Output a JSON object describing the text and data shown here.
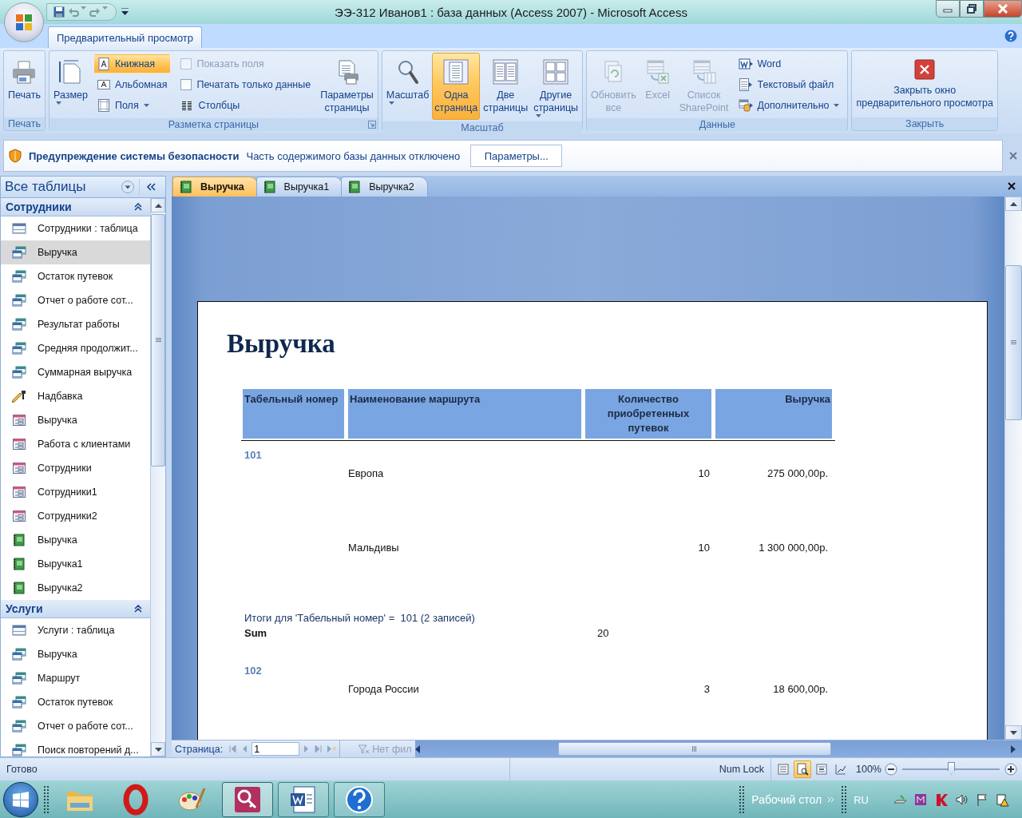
{
  "window": {
    "title": "ЭЭ-312 Иванов1 : база данных (Access 2007) - Microsoft Access"
  },
  "ribbon": {
    "tabs": [
      {
        "label": "Предварительный просмотр",
        "selected": true
      }
    ],
    "groups": [
      {
        "label": "Печать",
        "controls": [
          {
            "kind": "large",
            "label": "Печать"
          }
        ]
      },
      {
        "label": "Разметка страницы",
        "launcher": true,
        "controls": [
          {
            "kind": "large",
            "label": "Размер",
            "dropdown": true
          },
          {
            "kind": "stack",
            "items": [
              {
                "kind": "toggle",
                "label": "Книжная",
                "selected": true
              },
              {
                "kind": "toggle",
                "label": "Альбомная",
                "selected": false
              },
              {
                "kind": "small",
                "label": "Поля",
                "dropdown": true
              }
            ]
          },
          {
            "kind": "stack",
            "items": [
              {
                "kind": "check",
                "label": "Показать поля",
                "checked": false,
                "disabled": true
              },
              {
                "kind": "check",
                "label": "Печатать только данные",
                "checked": false,
                "disabled": false
              },
              {
                "kind": "small",
                "label": "Столбцы"
              }
            ]
          },
          {
            "kind": "large",
            "label": "Параметры\nстраницы"
          }
        ]
      },
      {
        "label": "Масштаб",
        "controls": [
          {
            "kind": "large",
            "label": "Масштаб",
            "dropdown": true,
            "selected": false
          },
          {
            "kind": "large",
            "label": "Одна\nстраница",
            "selected": true
          },
          {
            "kind": "large",
            "label": "Две\nстраницы",
            "selected": false
          },
          {
            "kind": "large",
            "label": "Другие\nстраницы",
            "dropdown": true,
            "selected": false
          }
        ]
      },
      {
        "label": "Данные",
        "controls": [
          {
            "kind": "large",
            "label": "Обновить\nвсе",
            "disabled": true
          },
          {
            "kind": "large",
            "label": "Excel\n ",
            "disabled": true
          },
          {
            "kind": "large",
            "label": "Список\nSharePoint",
            "disabled": true
          },
          {
            "kind": "stack",
            "items": [
              {
                "kind": "small",
                "label": "Word",
                "disabled": false
              },
              {
                "kind": "small",
                "label": "Текстовый файл",
                "disabled": false
              },
              {
                "kind": "small",
                "label": "Дополнительно",
                "dropdown": true,
                "disabled": false
              }
            ]
          }
        ]
      },
      {
        "label": "Закрыть",
        "controls": [
          {
            "kind": "large",
            "label": "Закрыть окно\nпредварительного просмотра"
          }
        ]
      }
    ]
  },
  "security_bar": {
    "title": "Предупреждение системы безопасности",
    "message": "Часть содержимого базы данных отключено",
    "button": "Параметры..."
  },
  "nav_pane": {
    "title": "Все таблицы",
    "groups": [
      {
        "label": "Сотрудники",
        "expanded": true,
        "items": [
          {
            "label": "Сотрудники : таблица",
            "kind": "table",
            "selected": false
          },
          {
            "label": "Выручка",
            "kind": "query",
            "selected": true
          },
          {
            "label": "Остаток путевок",
            "kind": "query",
            "selected": false
          },
          {
            "label": "Отчет о работе сот...",
            "kind": "query",
            "selected": false
          },
          {
            "label": "Результат работы",
            "kind": "query",
            "selected": false
          },
          {
            "label": "Средняя продолжит...",
            "kind": "query",
            "selected": false
          },
          {
            "label": "Суммарная выручка",
            "kind": "query",
            "selected": false
          },
          {
            "label": "Надбавка",
            "kind": "macro",
            "selected": false
          },
          {
            "label": "Выручка",
            "kind": "form",
            "selected": false
          },
          {
            "label": "Работа с клиентами",
            "kind": "form",
            "selected": false
          },
          {
            "label": "Сотрудники",
            "kind": "form",
            "selected": false
          },
          {
            "label": "Сотрудники1",
            "kind": "form",
            "selected": false
          },
          {
            "label": "Сотрудники2",
            "kind": "form",
            "selected": false
          },
          {
            "label": "Выручка",
            "kind": "report",
            "selected": false
          },
          {
            "label": "Выручка1",
            "kind": "report",
            "selected": false
          },
          {
            "label": "Выручка2",
            "kind": "report",
            "selected": false
          }
        ]
      },
      {
        "label": "Услуги",
        "expanded": true,
        "items": [
          {
            "label": "Услуги : таблица",
            "kind": "table",
            "selected": false
          },
          {
            "label": "Выручка",
            "kind": "query",
            "selected": false
          },
          {
            "label": "Маршрут",
            "kind": "query",
            "selected": false
          },
          {
            "label": "Остаток путевок",
            "kind": "query",
            "selected": false
          },
          {
            "label": "Отчет о работе сот...",
            "kind": "query",
            "selected": false
          },
          {
            "label": "Поиск повторений д...",
            "kind": "query",
            "selected": false
          }
        ]
      }
    ]
  },
  "doc_tabs": [
    {
      "label": "Выручка",
      "selected": true
    },
    {
      "label": "Выручка1",
      "selected": false
    },
    {
      "label": "Выручка2",
      "selected": false
    }
  ],
  "report": {
    "title": "Выручка",
    "columns": [
      "Табельный номер",
      "Наименование маршрута",
      "Количество приобретенных путевок",
      "Выручка"
    ],
    "groups": [
      {
        "key": "101",
        "rows": [
          {
            "route": "Европа",
            "count": "10",
            "revenue": "275 000,00р."
          },
          {
            "route": "Мальдивы",
            "count": "10",
            "revenue": "1 300 000,00р."
          }
        ],
        "summary": "Итоги для 'Табельный номер' =  101 (2 записей)",
        "sum_label": "Sum",
        "sum_value": "20"
      },
      {
        "key": "102",
        "rows": [
          {
            "route": "Города России",
            "count": "3",
            "revenue": "18 600,00р."
          }
        ]
      }
    ]
  },
  "record_nav": {
    "label": "Страница:",
    "value": "1",
    "filter": "Нет фил"
  },
  "status_bar": {
    "text": "Готово",
    "num_lock": "Num Lock",
    "views": [
      {
        "selected": false
      },
      {
        "selected": true
      },
      {
        "selected": false
      },
      {
        "selected": false
      }
    ],
    "zoom": "100%",
    "zoom_slider": {
      "level": 0.5
    }
  },
  "taskbar": {
    "apps": [
      {
        "running": false,
        "selected": false
      },
      {
        "running": false,
        "selected": false
      },
      {
        "running": false,
        "selected": false
      },
      {
        "running": true,
        "selected": true
      },
      {
        "running": true,
        "selected": false
      },
      {
        "running": true,
        "selected": false
      }
    ],
    "desktop": "Рабочий стол",
    "language": "RU"
  }
}
